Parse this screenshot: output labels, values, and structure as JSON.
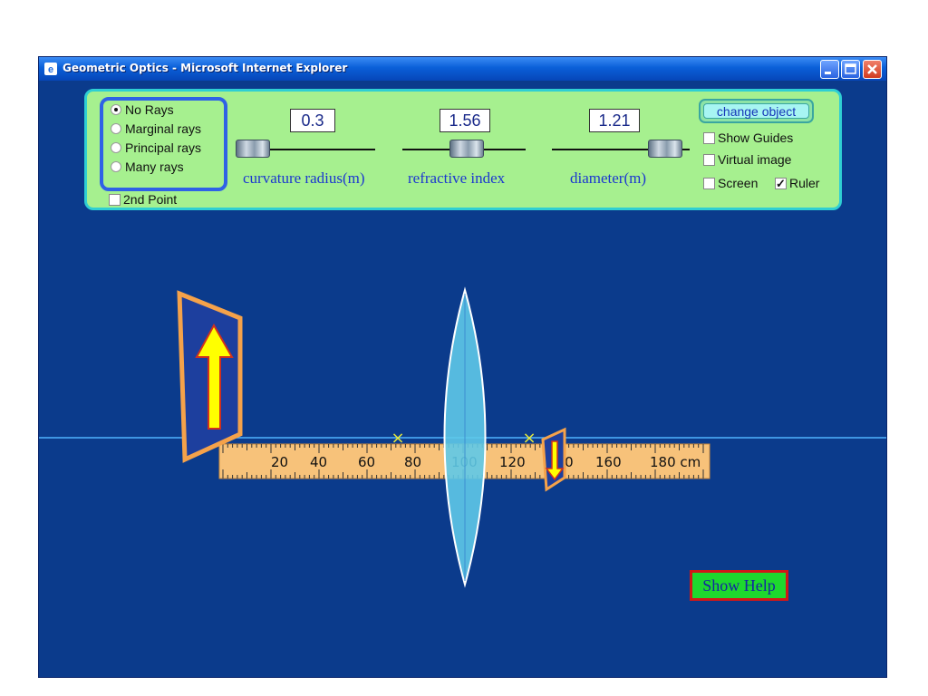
{
  "window": {
    "title": "Geometric Optics - Microsoft Internet Explorer",
    "buttons": [
      "minimize",
      "maximize",
      "close"
    ]
  },
  "controls": {
    "rays": {
      "options": [
        "No Rays",
        "Marginal rays",
        "Principal rays",
        "Many rays"
      ],
      "selected": "No Rays"
    },
    "second_point": {
      "label": "2nd Point",
      "checked": false
    },
    "sliders": [
      {
        "value": "0.3",
        "label": "curvature radius(m)",
        "level": 0.0
      },
      {
        "value": "1.56",
        "label": "refractive index",
        "level": 0.5
      },
      {
        "value": "1.21",
        "label": "diameter(m)",
        "level": 1.0
      }
    ],
    "change_object_label": "change object",
    "show_guides": {
      "label": "Show Guides",
      "checked": false
    },
    "virtual_image": {
      "label": "Virtual image",
      "checked": false
    },
    "screen": {
      "label": "Screen",
      "checked": false
    },
    "ruler": {
      "label": "Ruler",
      "checked": true,
      "checkmark": "✓"
    }
  },
  "ruler": {
    "ticks": [
      "20",
      "40",
      "60",
      "80",
      "100",
      "120",
      "140",
      "160",
      "180 cm"
    ]
  },
  "scene": {
    "object_arrow": "up",
    "image_arrow": "down",
    "focal_marker": "×"
  },
  "show_help_label": "Show Help",
  "colors": {
    "background": "#0b3b8c",
    "panel": "#a6f08f",
    "panel_border": "#2fcfd3",
    "radio_border": "#2f62e6",
    "arrow_fill": "#ffff00",
    "arrow_frame": "#f5a24a",
    "lens": "#5ec9e8",
    "axis": "#4fb3ff",
    "ruler": "#f7c27a",
    "focal_marker": "#e5e83a",
    "help_button": "#1ed82e",
    "help_border": "#d01818"
  }
}
